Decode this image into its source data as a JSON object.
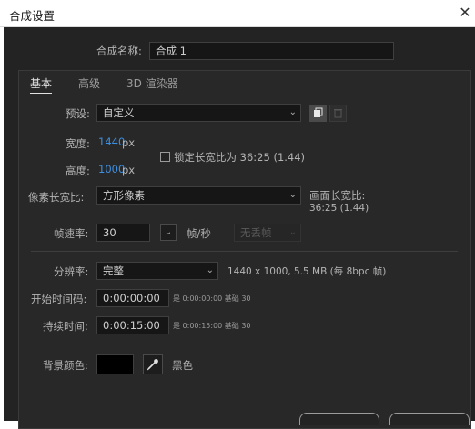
{
  "window": {
    "title": "合成设置",
    "close_glyph": "✕"
  },
  "comp_name": {
    "label": "合成名称:",
    "value": "合成 1"
  },
  "tabs": [
    {
      "label": "基本"
    },
    {
      "label": "高级"
    },
    {
      "label": "3D 渲染器"
    }
  ],
  "preset": {
    "label": "预设:",
    "value": "自定义"
  },
  "width": {
    "label": "宽度:",
    "value": "1440",
    "unit": "px"
  },
  "height": {
    "label": "高度:",
    "value": "1000",
    "unit": "px"
  },
  "lock_aspect": {
    "label": "锁定长宽比为 36:25 (1.44)",
    "checked": false
  },
  "pixel_aspect": {
    "label": "像素长宽比:",
    "value": "方形像素"
  },
  "frame_aspect": {
    "label": "画面长宽比:",
    "value": "36:25 (1.44)"
  },
  "frame_rate": {
    "label": "帧速率:",
    "value": "30",
    "unit": "帧/秒",
    "dropframe": "无丢帧"
  },
  "resolution": {
    "label": "分辨率:",
    "value": "完整",
    "info": "1440 x 1000, 5.5 MB (每 8bpc 帧)"
  },
  "start_timecode": {
    "label": "开始时间码:",
    "value": "0:00:00:00",
    "hint": "是 0:00:00:00  基础 30"
  },
  "duration": {
    "label": "持续时间:",
    "value": "0:00:15:00",
    "hint": "是 0:00:15:00  基础 30"
  },
  "background": {
    "label": "背景颜色:",
    "color_name": "黑色",
    "color": "#000000"
  },
  "colors": {
    "accent_blue": "#3d8fe0",
    "dialog_bg": "#232323"
  }
}
